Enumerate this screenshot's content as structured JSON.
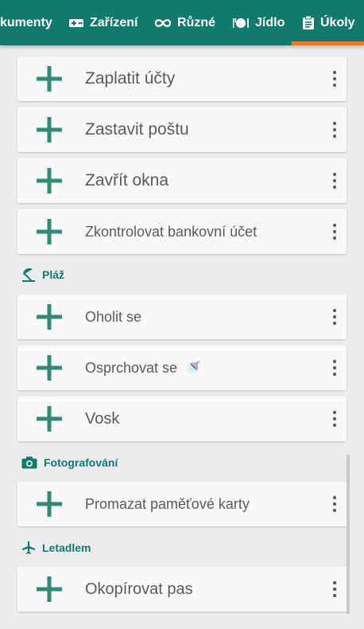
{
  "tabs": [
    {
      "label": "kumenty",
      "icon": "documents-icon"
    },
    {
      "label": "Zařízení",
      "icon": "gamepad-icon"
    },
    {
      "label": "Různé",
      "icon": "infinity-icon"
    },
    {
      "label": "Jídlo",
      "icon": "plate-cutlery-icon"
    },
    {
      "label": "Úkoly",
      "icon": "clipboard-icon",
      "active": true
    }
  ],
  "tasks_top": [
    {
      "label": "Zaplatit účty"
    },
    {
      "label": "Zastavit poštu"
    },
    {
      "label": "Zavřít okna"
    },
    {
      "label": "Zkontrolovat bankovní účet"
    }
  ],
  "sections": [
    {
      "title": "Pláž",
      "icon": "beach-umbrella-icon",
      "items": [
        {
          "label": "Oholit se"
        },
        {
          "label": "Osprchovat se",
          "emoji": "🚿"
        },
        {
          "label": "Vosk"
        }
      ]
    },
    {
      "title": "Fotografování",
      "icon": "camera-icon",
      "items": [
        {
          "label": "Promazat paměťové karty"
        }
      ]
    },
    {
      "title": "Letadlem",
      "icon": "airplane-icon",
      "items": [
        {
          "label": "Okopírovat pas"
        }
      ]
    }
  ],
  "colors": {
    "accent": "#127a6a",
    "indicator": "#f07a1a",
    "plus": "#2e8b74"
  }
}
